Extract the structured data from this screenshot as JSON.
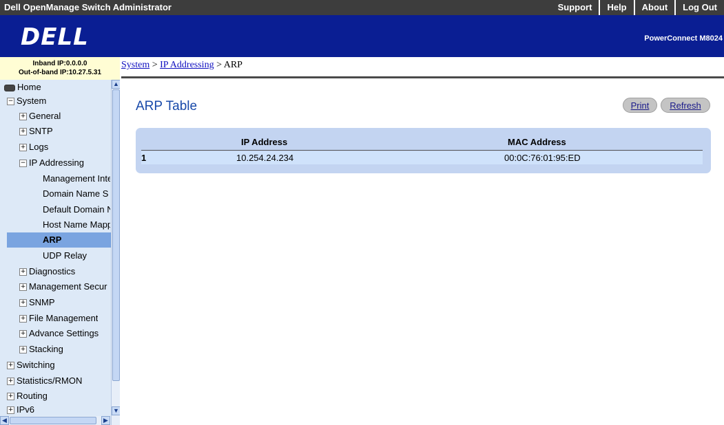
{
  "topbar": {
    "title": "Dell OpenManage Switch Administrator",
    "links": [
      "Support",
      "Help",
      "About",
      "Log Out"
    ]
  },
  "banner": {
    "logo": "DELL",
    "model": "PowerConnect M8024"
  },
  "ipinfo": {
    "inband": "Inband IP:0.0.0.0",
    "outband": "Out-of-band IP:10.27.5.31"
  },
  "breadcrumb": {
    "items": [
      "System",
      "IP Addressing"
    ],
    "separator": ">",
    "current": "ARP"
  },
  "sidebar": {
    "items": [
      {
        "label": "Home"
      },
      {
        "label": "System"
      },
      {
        "label": "General"
      },
      {
        "label": "SNTP"
      },
      {
        "label": "Logs"
      },
      {
        "label": "IP Addressing"
      },
      {
        "label": "Management Inte"
      },
      {
        "label": "Domain Name S"
      },
      {
        "label": "Default Domain N"
      },
      {
        "label": "Host Name Mapp"
      },
      {
        "label": "ARP"
      },
      {
        "label": "UDP Relay"
      },
      {
        "label": "Diagnostics"
      },
      {
        "label": "Management Secur"
      },
      {
        "label": "SNMP"
      },
      {
        "label": "File Management"
      },
      {
        "label": "Advance Settings"
      },
      {
        "label": "Stacking"
      },
      {
        "label": "Switching"
      },
      {
        "label": "Statistics/RMON"
      },
      {
        "label": "Routing"
      },
      {
        "label": "IPv6"
      }
    ],
    "expand_symbols": {
      "plus": "+",
      "minus": "−"
    }
  },
  "main": {
    "title": "ARP Table",
    "print_label": "Print",
    "refresh_label": "Refresh",
    "table": {
      "headers": [
        "IP Address",
        "MAC Address"
      ],
      "rows": [
        {
          "index": "1",
          "ip": "10.254.24.234",
          "mac": "00:0C:76:01:95:ED"
        }
      ]
    }
  },
  "colors": {
    "topbar": "#3d3d3d",
    "banner": "#0a1e93",
    "sidebar": "#dde9f7",
    "selected": "#7aa4e0",
    "title": "#1849a9",
    "table_bg": "#c3d4f1"
  }
}
